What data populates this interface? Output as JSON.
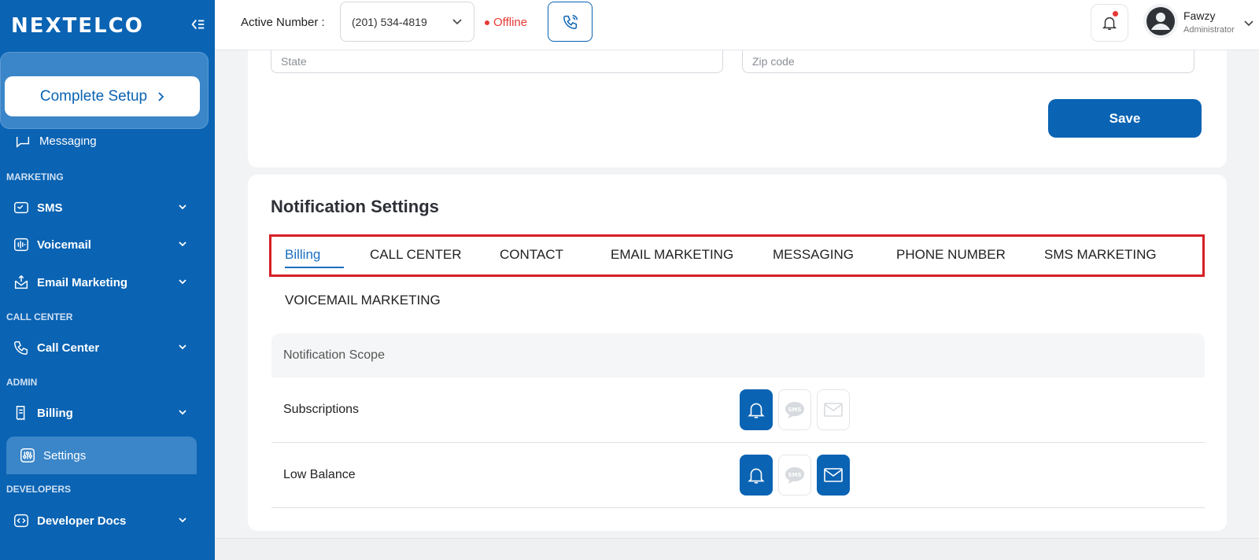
{
  "brand": {
    "logo_text": "NEXTELCO"
  },
  "sidebar": {
    "setup_label": "Complete Setup",
    "peek_item": "Messaging",
    "sections": {
      "marketing": "MARKETING",
      "call_center": "CALL CENTER",
      "admin": "ADMIN",
      "developers": "DEVELOPERS"
    },
    "items": [
      {
        "label": "SMS"
      },
      {
        "label": "Voicemail"
      },
      {
        "label": "Email Marketing"
      },
      {
        "label": "Call Center"
      },
      {
        "label": "Billing"
      },
      {
        "label": "Settings"
      },
      {
        "label": "Developer Docs"
      }
    ]
  },
  "topbar": {
    "active_label": "Active Number :",
    "active_number": "(201) 534-4819",
    "status": "Offline",
    "user": {
      "name": "Fawzy",
      "role": "Administrator"
    }
  },
  "form": {
    "state_placeholder": "State",
    "zip_placeholder": "Zip code",
    "save_label": "Save"
  },
  "notifications": {
    "title": "Notification Settings",
    "tabs": [
      "Billing",
      "CALL CENTER",
      "CONTACT",
      "EMAIL MARKETING",
      "MESSAGING",
      "PHONE NUMBER",
      "SMS MARKETING",
      "VOICEMAIL MARKETING"
    ],
    "active_tab": "Billing",
    "scope_header": "Notification Scope",
    "rows": [
      {
        "label": "Subscriptions",
        "push": true,
        "sms": false,
        "email": false
      },
      {
        "label": "Low Balance",
        "push": true,
        "sms": false,
        "email": true
      }
    ],
    "channel_icons": [
      "bell-icon",
      "sms-icon",
      "mail-icon"
    ]
  },
  "colors": {
    "primary": "#0a63b3",
    "danger": "#e53935",
    "highlight_border": "#d61f26"
  }
}
